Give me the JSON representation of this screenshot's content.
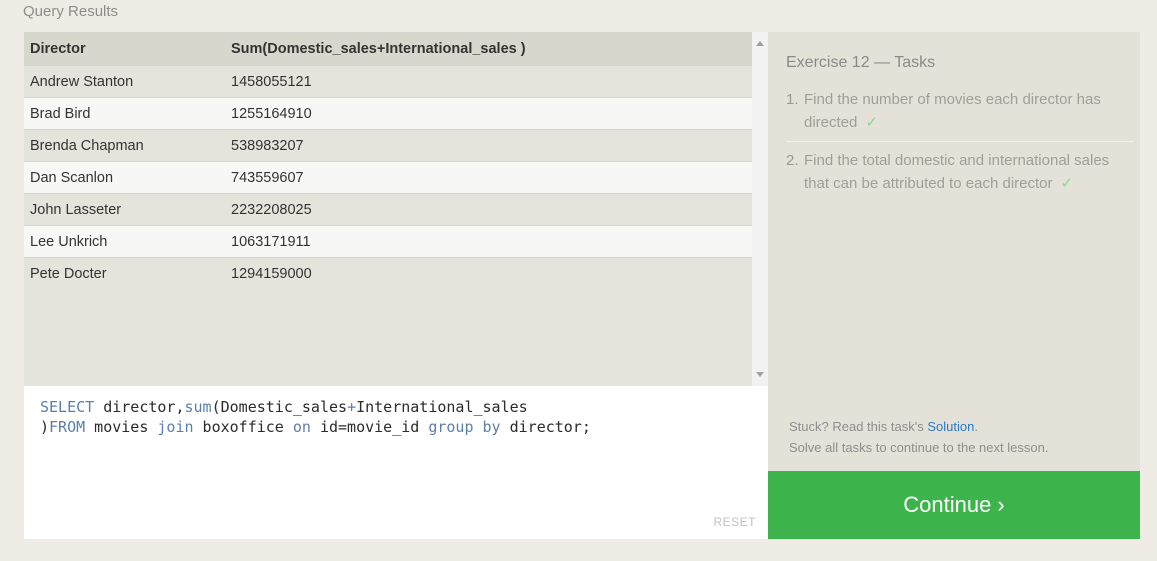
{
  "query_results": {
    "title": "Query Results",
    "columns": [
      "Director",
      "Sum(Domestic_sales+International_sales )"
    ],
    "rows": [
      [
        "Andrew Stanton",
        "1458055121"
      ],
      [
        "Brad Bird",
        "1255164910"
      ],
      [
        "Brenda Chapman",
        "538983207"
      ],
      [
        "Dan Scanlon",
        "743559607"
      ],
      [
        "John Lasseter",
        "2232208025"
      ],
      [
        "Lee Unkrich",
        "1063171911"
      ],
      [
        "Pete Docter",
        "1294159000"
      ]
    ]
  },
  "editor": {
    "line1": "SELECT director,sum(Domestic_sales+International_sales",
    "line2": ")FROM movies join boxoffice on id=movie_id group by director;",
    "reset_label": "RESET"
  },
  "tasks_panel": {
    "title": "Exercise 12 — Tasks",
    "tasks": [
      {
        "num": "1.",
        "text": "Find the number of movies each director has directed",
        "check": "✓"
      },
      {
        "num": "2.",
        "text": "Find the total domestic and international sales that can be attributed to each director",
        "check": "✓"
      }
    ],
    "stuck_prefix": "Stuck? Read this task's ",
    "solution_link": "Solution",
    "stuck_suffix": ".",
    "solve_all": "Solve all tasks to continue to the next lesson."
  },
  "continue_button": {
    "label": "Continue ›"
  },
  "colors": {
    "continue_green": "#3cb44b",
    "keyword_blue": "#5b7fa8",
    "link_blue": "#2f78c4",
    "check_green": "#8fd49b"
  }
}
